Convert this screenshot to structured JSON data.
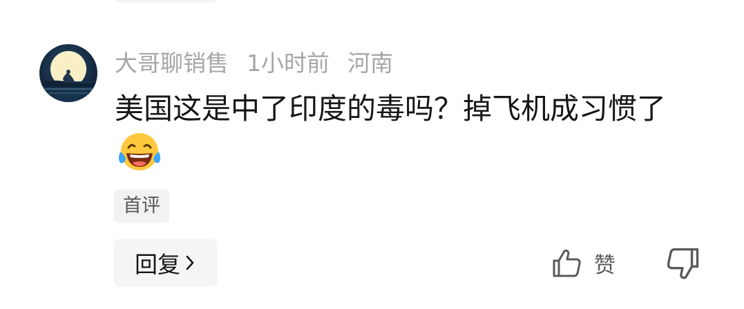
{
  "comment": {
    "username": "大哥聊销售",
    "time": "1小时前",
    "location": "河南",
    "content": "美国这是中了印度的毒吗？掉飞机成习惯了",
    "emoji": "laughing-crying-emoji",
    "tag": "首评"
  },
  "actions": {
    "reply_label": "回复",
    "like_label": "赞"
  },
  "icons": {
    "reply_chevron": "chevron-right-icon",
    "like": "thumbs-up-icon",
    "dislike": "thumbs-down-icon"
  },
  "colors": {
    "meta_text": "#a6a6a6",
    "content_text": "#161616",
    "button_bg": "#f5f5f5",
    "tag_bg": "#f2f2f2"
  }
}
